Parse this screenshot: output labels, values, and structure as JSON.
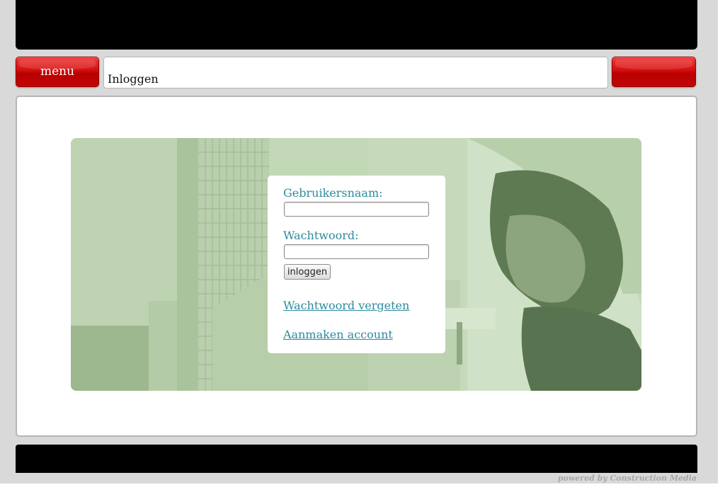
{
  "nav": {
    "menu_label": "menu",
    "right_label": ""
  },
  "page": {
    "title": "Inloggen"
  },
  "login": {
    "username_label": "Gebruikersnaam:",
    "username_value": "",
    "password_label": "Wachtwoord:",
    "password_value": "",
    "submit_label": "inloggen",
    "forgot_link": "Wachtwoord vergeten",
    "create_link": "Aanmaken account"
  },
  "footer": {
    "powered_by": "powered by Construction Media"
  },
  "colors": {
    "accent_red": "#d40e0e",
    "link_teal": "#2e8a9e",
    "banner_black": "#000000",
    "page_gray": "#d9d9d9",
    "hero_green": "#c9dcbf"
  },
  "icons": {
    "hero_image": "hero-photo-icon"
  }
}
